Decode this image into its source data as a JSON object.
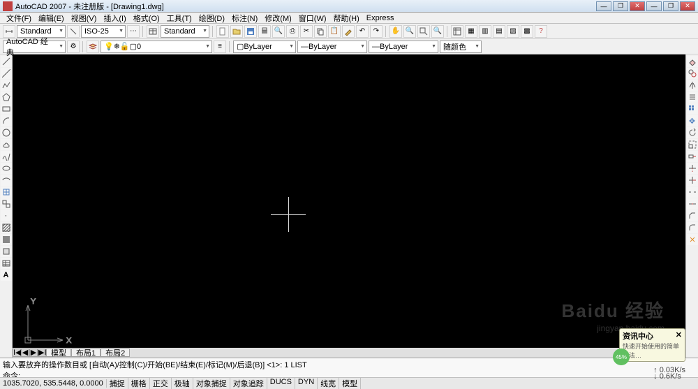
{
  "window": {
    "title": "AutoCAD 2007 - 未注册版 - [Drawing1.dwg]"
  },
  "menu": {
    "items": [
      "文件(F)",
      "编辑(E)",
      "视图(V)",
      "插入(I)",
      "格式(O)",
      "工具(T)",
      "绘图(D)",
      "标注(N)",
      "修改(M)",
      "窗口(W)",
      "帮助(H)",
      "Express"
    ]
  },
  "toolbar1": {
    "style_dd": "Standard",
    "dim_dd": "ISO-25",
    "text_dd": "Standard"
  },
  "toolbar2": {
    "workspace_dd": "AutoCAD 经典",
    "layer_dd": "0",
    "color_layer": "ByLayer",
    "linetype": "ByLayer",
    "lineweight": "ByLayer",
    "plotcolor": "随颜色"
  },
  "tabs": {
    "nav": [
      "I◀",
      "◀",
      "▶",
      "▶I"
    ],
    "items": [
      "模型",
      "布局1",
      "布局2"
    ]
  },
  "command": {
    "line1": "输入要放弃的操作数目或 [自动(A)/控制(C)/开始(BE)/结束(E)/标记(M)/后退(B)] <1>: 1 LIST",
    "line2": "命令:"
  },
  "status": {
    "coords": "1035.7020, 535.5448, 0.0000",
    "modes": [
      "捕捉",
      "栅格",
      "正交",
      "极轴",
      "对象捕捉",
      "对象追踪",
      "DUCS",
      "DYN",
      "线宽",
      "模型"
    ]
  },
  "popup": {
    "title": "资讯中心",
    "body": "快速开始使用的简单方法…",
    "percent": "45%"
  },
  "watermark": {
    "main": "Baidu 经验",
    "sub": "jingyan.baidu.com"
  },
  "speed": {
    "up": "↑ 0.03K/s",
    "down": "↓ 0.6K/s"
  },
  "icons": {
    "line": "line-icon",
    "pline": "pline-icon",
    "arc": "arc-icon",
    "circle": "circle-icon",
    "erase": "erase-icon",
    "copy": "copy-icon",
    "mirror": "mirror-icon",
    "move": "move-icon"
  }
}
